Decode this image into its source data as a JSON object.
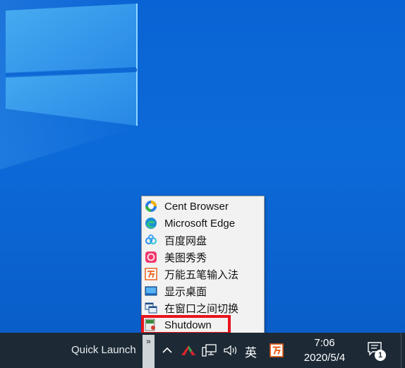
{
  "menu": {
    "items": [
      {
        "label": "Cent Browser",
        "icon": "cent-browser-icon"
      },
      {
        "label": "Microsoft Edge",
        "icon": "edge-icon"
      },
      {
        "label": "百度网盘",
        "icon": "baidu-netdisk-icon"
      },
      {
        "label": "美图秀秀",
        "icon": "meitu-icon"
      },
      {
        "label": "万能五笔输入法",
        "icon": "wanneng-wubi-icon"
      },
      {
        "label": "显示桌面",
        "icon": "show-desktop-icon"
      },
      {
        "label": "在窗口之间切换",
        "icon": "switch-windows-icon"
      },
      {
        "label": "Shutdown",
        "icon": "shutdown-icon"
      }
    ]
  },
  "taskbar": {
    "quick_launch_label": "Quick Launch",
    "chevron": "»",
    "ime_label": "英",
    "time": "7:06",
    "date": "2020/5/4",
    "notification_count": "1"
  },
  "colors": {
    "desktop": "#0c6ad8",
    "taskbar": "#1d2a36",
    "highlight": "#e8141c"
  }
}
